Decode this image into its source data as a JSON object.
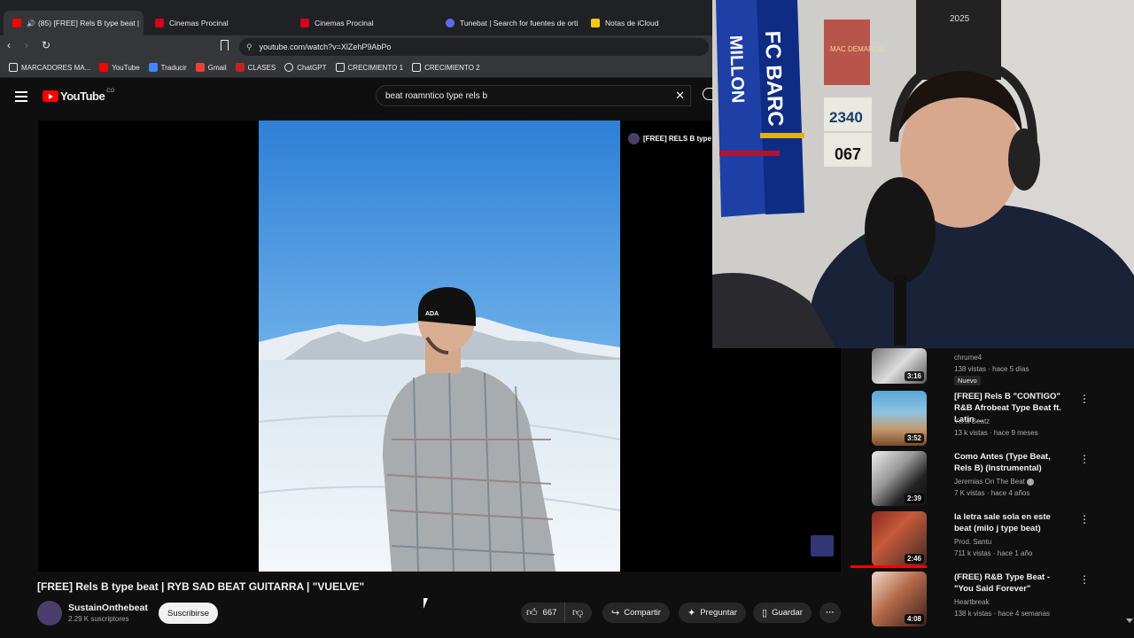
{
  "tabs": [
    {
      "label": "(85) [FREE] Rels B type beat | ",
      "active": true,
      "fav_color": "#ff0000"
    },
    {
      "label": "Cinemas Procinal",
      "active": false,
      "fav_color": "#d6001c"
    },
    {
      "label": "Cinemas Procinal",
      "active": false,
      "fav_color": "#d6001c"
    },
    {
      "label": "Tunebat | Search for fuentes de ortiz",
      "active": false,
      "fav_color": "#5a6cf0"
    },
    {
      "label": "Notas de iCloud",
      "active": false,
      "fav_color": "#f5c518"
    }
  ],
  "address": {
    "url": "youtube.com/watch?v=XlZehP9AbPo"
  },
  "bookmarks": [
    {
      "label": "MARCADORES MA...",
      "icon": "folder-icon"
    },
    {
      "label": "YouTube",
      "icon": "youtube-icon"
    },
    {
      "label": "Traducir",
      "icon": "translate-icon"
    },
    {
      "label": "Gmail",
      "icon": "gmail-icon"
    },
    {
      "label": "CLASES",
      "icon": "clases-icon"
    },
    {
      "label": "ChatGPT",
      "icon": "chatgpt-icon"
    },
    {
      "label": "CRECIMIENTO 1",
      "icon": "folder-icon"
    },
    {
      "label": "CRECIMIENTO 2",
      "icon": "folder-icon"
    }
  ],
  "youtube": {
    "logo_text": "YouTube",
    "country": "CO",
    "search_value": "beat roamntico type rels b"
  },
  "video": {
    "title": "[FREE] Rels B type beat | RYB SAD BEAT GUITARRA | \"VUELVE\"",
    "overlay_title": "[FREE] RELS B type be",
    "channel": "SustainOnthebeat",
    "subscribers": "2.29 K suscriptores",
    "subscribe_label": "Suscribirse",
    "likes": "667",
    "share_label": "Compartir",
    "ask_label": "Preguntar",
    "save_label": "Guardar"
  },
  "recommendations": [
    {
      "title": "",
      "channel": "chrume4",
      "meta": "138 vistas · hace 5 días",
      "badge": "Nuevo",
      "duration": "3:16"
    },
    {
      "title": "[FREE] Rels B \"CONTIGO\" R&B Afrobeat Type Beat ft. Latin ...",
      "channel": "Yersi Beatz",
      "meta": "13 k vistas · hace 9 meses",
      "duration": "3:52"
    },
    {
      "title": "Como Antes (Type Beat, Rels B) (Instrumental)",
      "channel": "Jeremias On The Beat",
      "meta": "7 K vistas · hace 4 años",
      "duration": "2:39"
    },
    {
      "title": "la letra sale sola en este beat (milo j type beat)",
      "channel": "Prod. Santu",
      "meta": "711 k vistas · hace 1 año",
      "duration": "2:46"
    },
    {
      "title": "(FREE) R&B Type Beat - \"You Said Forever\"",
      "channel": "Heartbreak",
      "meta": "138 k vistas · hace 4 semanas",
      "duration": "4:08"
    }
  ],
  "webcam": {
    "scarf_text": "FC BARC",
    "scarf_text2": "MILLON",
    "poster_text": "MAC DEMARCO",
    "bib_number": "2340",
    "bib_number2": "067",
    "calendar_year": "2025"
  }
}
